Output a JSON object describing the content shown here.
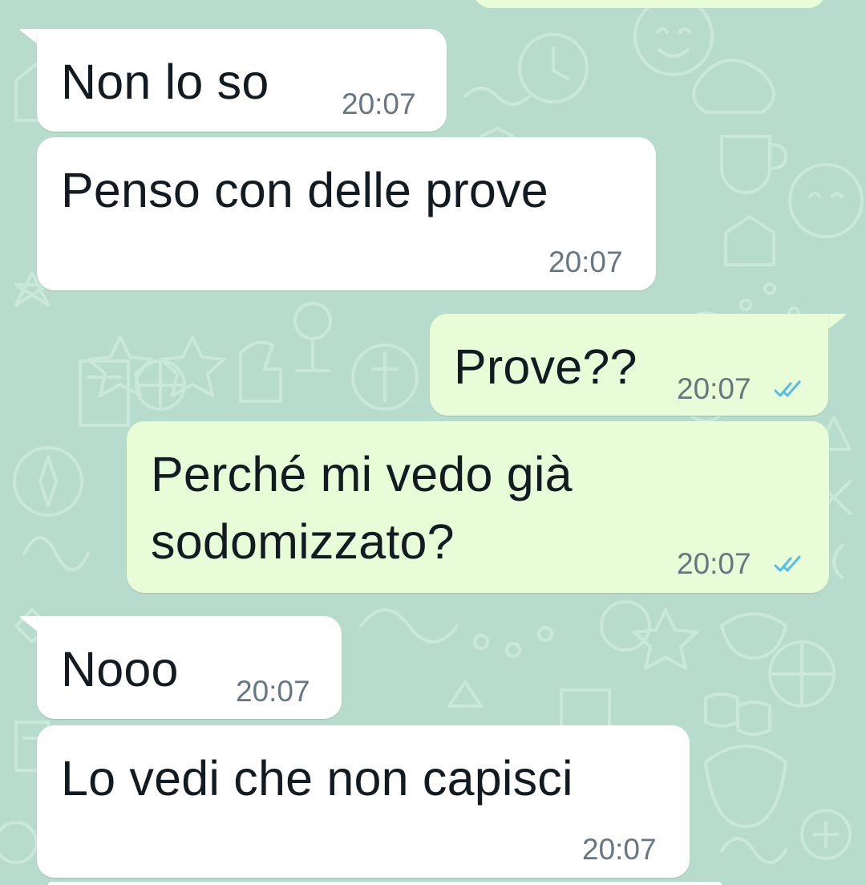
{
  "chat": {
    "messages": [
      {
        "id": "m1",
        "direction": "incoming",
        "lines": [
          "Non lo so"
        ],
        "time": "20:07"
      },
      {
        "id": "m2",
        "direction": "incoming",
        "lines": [
          "Penso con delle prove"
        ],
        "time": "20:07"
      },
      {
        "id": "m3",
        "direction": "outgoing",
        "lines": [
          "Prove??"
        ],
        "time": "20:07",
        "status": "read"
      },
      {
        "id": "m4",
        "direction": "outgoing",
        "lines": [
          "Perché mi vedo già",
          "sodomizzato?"
        ],
        "time": "20:07",
        "status": "read"
      },
      {
        "id": "m5",
        "direction": "incoming",
        "lines": [
          "Nooo"
        ],
        "time": "20:07"
      },
      {
        "id": "m6",
        "direction": "incoming",
        "lines": [
          "Lo vedi che non capisci"
        ],
        "time": "20:07"
      }
    ]
  },
  "colors": {
    "wallpaper": "#b7dccd",
    "incoming_bubble": "#ffffff",
    "outgoing_bubble": "#e7fcd7",
    "text": "#111b21",
    "timestamp": "#667781",
    "read_ticks": "#53bdeb"
  },
  "icons": {
    "read_receipt": "double-check-icon"
  }
}
